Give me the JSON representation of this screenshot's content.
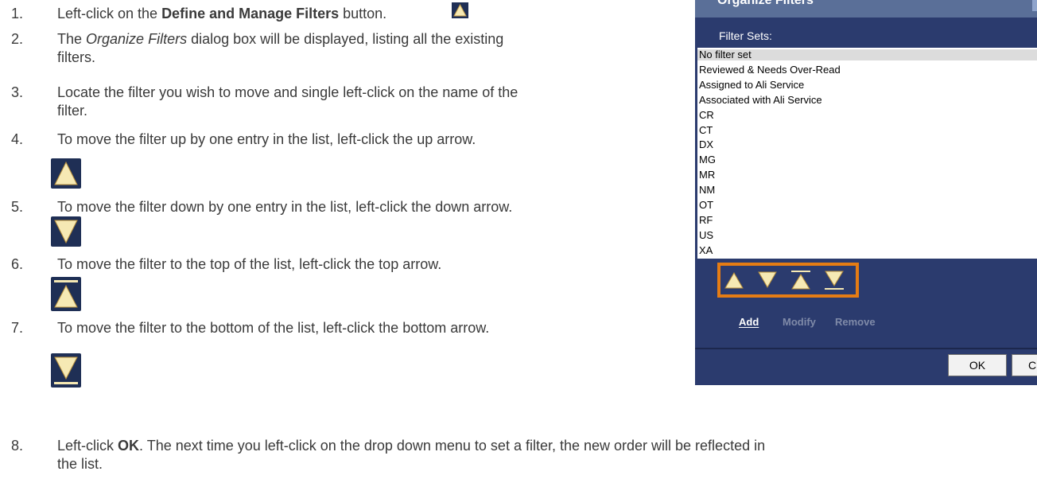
{
  "steps": [
    {
      "n": "1.",
      "pre": "Left-click on the ",
      "bold": "Define and Manage Filters",
      "post": " button."
    },
    {
      "n": "2.",
      "pre": "The ",
      "italic": "Organize Filters",
      "post": " dialog box will be displayed, listing all the existing",
      "cont": "filters."
    },
    {
      "n": "3.",
      "text": "Locate the filter you wish to move and single left-click on the name of the",
      "cont": "filter."
    },
    {
      "n": "4.",
      "text": "To move the filter up by one entry in the list, left-click the up arrow."
    },
    {
      "n": "5.",
      "text": "To move the filter down by one entry in the list, left-click the down arrow."
    },
    {
      "n": "6.",
      "text": "To move the filter to the top of the list, left-click the top arrow."
    },
    {
      "n": "7.",
      "text": "To move the filter to the bottom of the list, left-click the bottom arrow."
    },
    {
      "n": "8.",
      "pre": "Left-click ",
      "bold": "OK",
      "post": ". The next time you left-click on the drop down menu to set a filter, the new order will be reflected in",
      "cont": "the list."
    }
  ],
  "dialog": {
    "title": "Organize Filters",
    "filter_sets_label": "Filter Sets:",
    "filter_sets": [
      "No filter set",
      "Reviewed & Needs Over-Read",
      "Assigned to Ali Service",
      "Associated with Ali Service",
      "CR",
      "CT",
      "DX",
      "MG",
      "MR",
      "NM",
      "OT",
      "RF",
      "US",
      "XA"
    ],
    "selected_index": 0,
    "actions": {
      "add": "Add",
      "modify": "Modify",
      "remove": "Remove"
    },
    "ok": "OK",
    "cancel_partial": "C",
    "highlight_color": "#e57c14"
  },
  "icons": [
    "filter-icon",
    "up-arrow-icon",
    "down-arrow-icon",
    "top-arrow-icon",
    "bottom-arrow-icon"
  ]
}
